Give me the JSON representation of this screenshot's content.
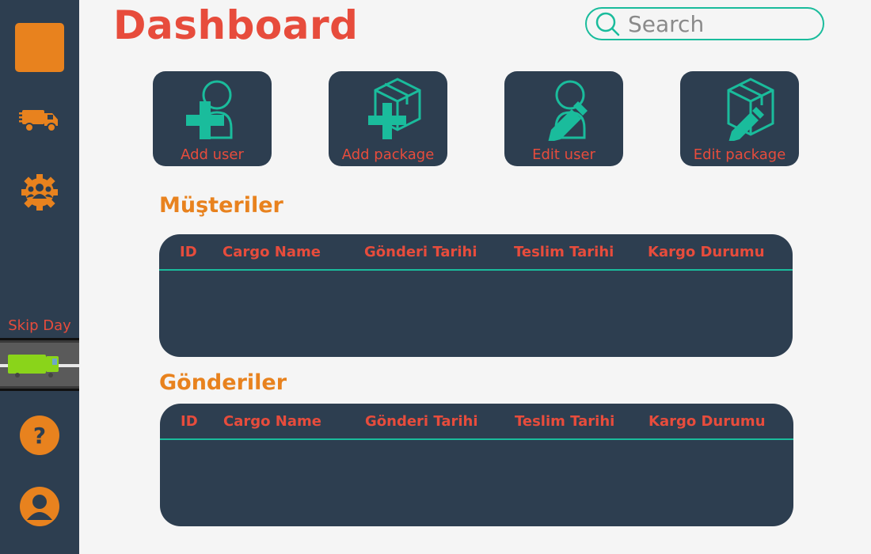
{
  "page": {
    "title": "Dashboard"
  },
  "search": {
    "placeholder": "Search"
  },
  "sidebar": {
    "skip_day_label": "Skip Day",
    "help_glyph": "?"
  },
  "actions": [
    {
      "label": "Add user",
      "icon": "add-user-icon"
    },
    {
      "label": "Add package",
      "icon": "add-package-icon"
    },
    {
      "label": "Edit user",
      "icon": "edit-user-icon"
    },
    {
      "label": "Edit package",
      "icon": "edit-package-icon"
    }
  ],
  "tables": [
    {
      "title": "Müşteriler",
      "columns": [
        "ID",
        "Cargo Name",
        "Gönderi Tarihi",
        "Teslim Tarihi",
        "Kargo Durumu"
      ],
      "rows": []
    },
    {
      "title": "Gönderiler",
      "columns": [
        "ID",
        "Cargo Name",
        "Gönderi Tarihi",
        "Teslim Tarihi",
        "Kargo Durumu"
      ],
      "rows": []
    }
  ],
  "colors": {
    "sidebar": "#2d3e50",
    "accent_orange": "#e8821e",
    "accent_red": "#e74c3c",
    "accent_teal": "#1abc9c",
    "background": "#f5f5f5"
  }
}
